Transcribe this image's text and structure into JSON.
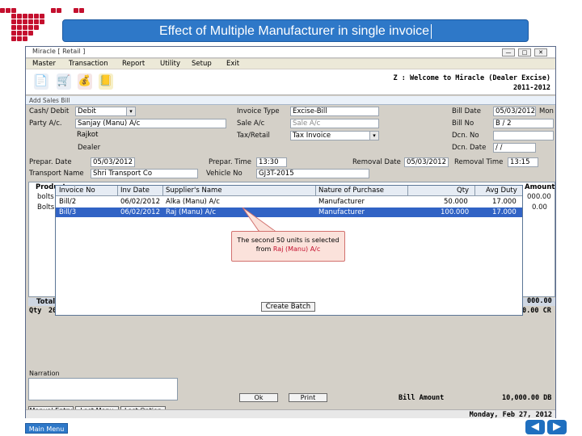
{
  "slide": {
    "title": "Effect of Multiple Manufacturer in single invoice",
    "main_menu": "Main Menu",
    "prev_icon": "arrow-left",
    "next_icon": "arrow-right",
    "accent_color": "#2e78c8",
    "decor_color": "#c4102e"
  },
  "window": {
    "title": "Miracle [ Retail ]",
    "menu": [
      "Master",
      "Transaction",
      "Report",
      "Utility",
      "Setup",
      "Exit"
    ],
    "welcome_line1": "Z : Welcome to Miracle (Dealer Excise)",
    "welcome_line2": "2011-2012",
    "form_title": "Add Sales Bill"
  },
  "form": {
    "cash_debit_label": "Cash/ Debit",
    "cash_debit_value": "Debit",
    "party_label": "Party A/c.",
    "party_value": "Sanjay (Manu) A/c",
    "city_value": "Rajkot",
    "dealer_label": "Dealer",
    "invoice_type_label": "Invoice Type",
    "invoice_type_value": "Excise-Bill",
    "sale_ac_label": "Sale A/c",
    "sale_ac_value": "Sale A/c",
    "tax_retail_label": "Tax/Retail",
    "tax_retail_value": "Tax Invoice",
    "bill_date_label": "Bill Date",
    "bill_date_value": "05/03/2012",
    "bill_date_day": "Mon",
    "bill_no_label": "Bill No",
    "bill_no_value": "B / 2",
    "dcn_no_label": "Dcn. No",
    "dcn_date_label": "Dcn. Date",
    "dcn_date_value": "/ /",
    "prepare_date_label": "Prepar. Date",
    "prepare_date_value": "05/03/2012",
    "prepare_time_label": "Prepar. Time",
    "prepare_time_value": "13:30",
    "removal_date_label": "Removal Date",
    "removal_date_value": "05/03/2012",
    "removal_time_label": "Removal Time",
    "removal_time_value": "13:15",
    "transport_label": "Transport Name",
    "transport_value": "Shri Transport Co",
    "vehicle_label": "Vehicle No",
    "vehicle_value": "GJ3T-2015"
  },
  "grid_bg": {
    "product_header": "Product",
    "amount_header": "Amount",
    "row1_product": "bolts",
    "row2_product": "Bolts",
    "row1_amount": "000.00",
    "row2_amount": "0.00",
    "total_label": "Total",
    "qty_label": "Qty",
    "qty_value": "20",
    "total_amount": "000.00",
    "total_cr": "0.00 CR"
  },
  "popup": {
    "headers": [
      "Invoice No",
      "Inv Date",
      "Supplier's Name",
      "Nature of Purchase",
      "Qty",
      "Avg Duty"
    ],
    "rows": [
      {
        "invoice": "Bill/2",
        "date": "06/02/2012",
        "supplier": "Alka (Manu) A/c",
        "nature": "Manufacturer",
        "qty": "50.000",
        "duty": "17.000"
      },
      {
        "invoice": "Bill/3",
        "date": "06/02/2012",
        "supplier": "Raj (Manu) A/c",
        "nature": "Manufacturer",
        "qty": "100.000",
        "duty": "17.000"
      }
    ],
    "create_batch": "Create Batch"
  },
  "callout": {
    "line1": "The second 50 units is selected",
    "line2_prefix": "from ",
    "line2_highlight": "Raj (Manu) A/c"
  },
  "footer": {
    "narration_label": "Narration",
    "ok": "Ok",
    "print": "Print",
    "bill_amount_label": "Bill Amount",
    "bill_amount_value": "10,000.00 DB",
    "manual_entry": "Manual Entry",
    "last_menu": "Last Menu",
    "last_option": "Last Option",
    "status_date": "Monday, Feb 27, 2012"
  }
}
